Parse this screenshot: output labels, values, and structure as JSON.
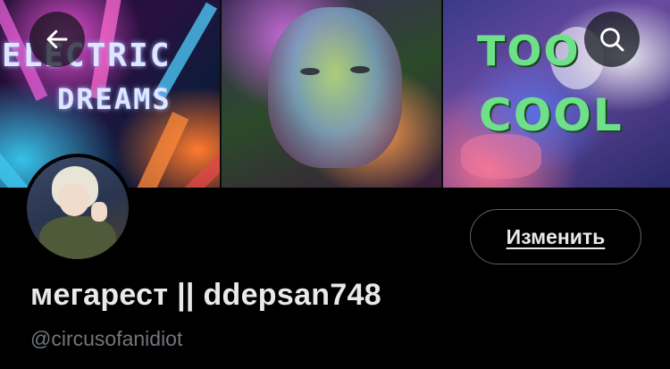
{
  "banner": {
    "panel_left_text_line1": "ELECTRIC",
    "panel_left_text_line2": "DREAMS",
    "panel_right_text_line1": "TOO",
    "panel_right_text_line2": "COOL"
  },
  "nav": {
    "back_icon": "arrow-left-icon",
    "search_icon": "search-icon"
  },
  "profile": {
    "edit_button_label": "Изменить",
    "display_name": "мегарест || ddepsan748",
    "handle": "@circusofanidiot"
  },
  "colors": {
    "background": "#000000",
    "primary_text": "#e7e9ea",
    "secondary_text": "#71767b",
    "button_border": "#536471",
    "overlay_button_bg": "rgba(15,20,25,0.72)"
  }
}
